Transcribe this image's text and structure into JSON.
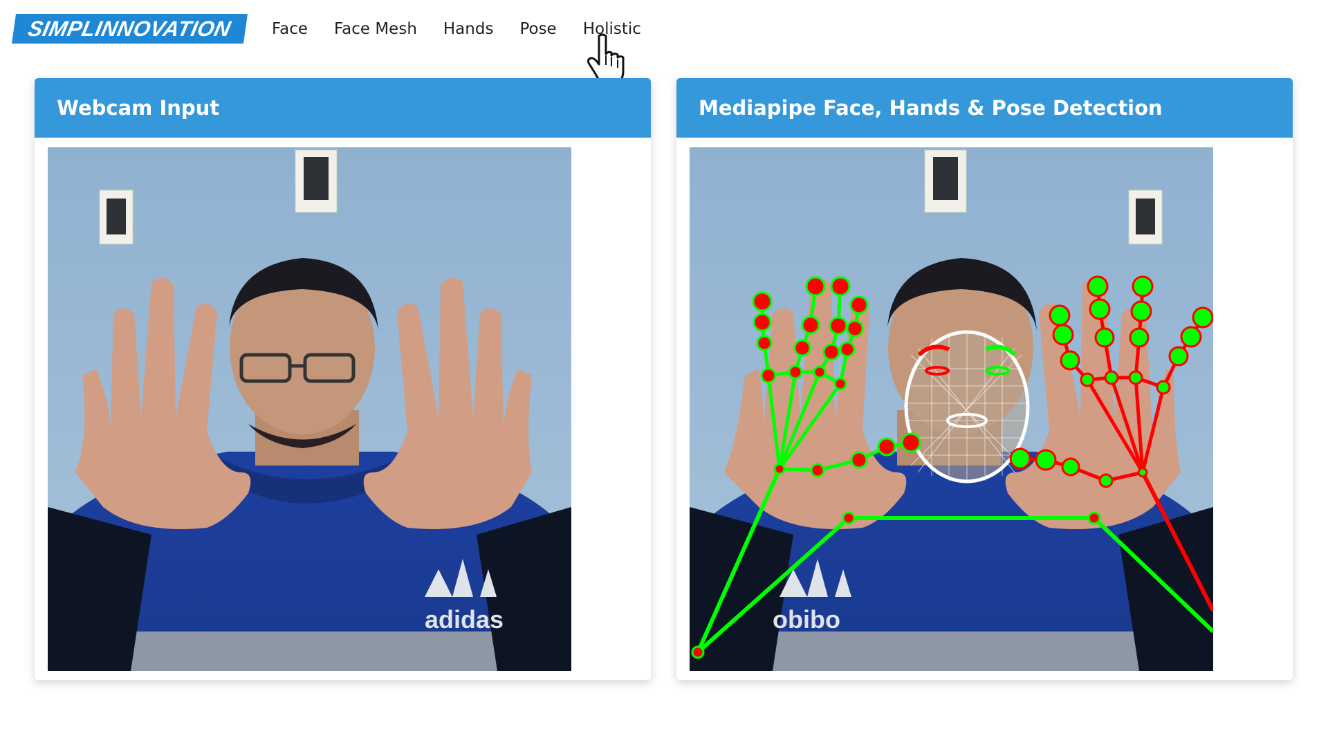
{
  "brand": {
    "name": "SIMPLINNOVATION"
  },
  "nav": {
    "items": [
      {
        "label": "Face"
      },
      {
        "label": "Face Mesh"
      },
      {
        "label": "Hands"
      },
      {
        "label": "Pose"
      },
      {
        "label": "Holistic"
      }
    ],
    "hovered": "Holistic"
  },
  "panels": {
    "input": {
      "title": "Webcam Input"
    },
    "output": {
      "title": "Mediapipe Face, Hands & Pose Detection"
    }
  },
  "colors": {
    "brand": "#1e88d6",
    "card_header": "#3498db",
    "landmark_red": "#ff0000",
    "landmark_green": "#00ff00"
  },
  "icons": {
    "cursor": "hand-pointer-icon"
  }
}
